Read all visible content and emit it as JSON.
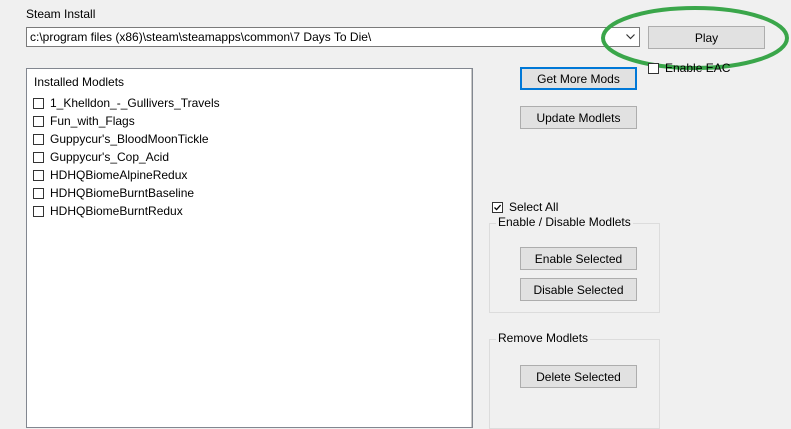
{
  "steam_install": {
    "label": "Steam Install",
    "path": "c:\\program files (x86)\\steam\\steamapps\\common\\7 Days To Die\\"
  },
  "buttons": {
    "play": "Play",
    "get_more_mods": "Get More Mods",
    "update_modlets": "Update Modlets",
    "enable_selected": "Enable Selected",
    "disable_selected": "Disable Selected",
    "delete_selected": "Delete Selected"
  },
  "enable_eac": {
    "label": "Enable EAC",
    "checked": false
  },
  "modlets": {
    "title": "Installed Modlets",
    "items": [
      {
        "name": "1_Khelldon_-_Gullivers_Travels",
        "checked": false
      },
      {
        "name": "Fun_with_Flags",
        "checked": false
      },
      {
        "name": "Guppycur's_BloodMoonTickle",
        "checked": false
      },
      {
        "name": "Guppycur's_Cop_Acid",
        "checked": false
      },
      {
        "name": "HDHQBiomeAlpineRedux",
        "checked": false
      },
      {
        "name": "HDHQBiomeBurntBaseline",
        "checked": false
      },
      {
        "name": "HDHQBiomeBurntRedux",
        "checked": false
      }
    ]
  },
  "select_all": {
    "label": "Select All",
    "checked": true
  },
  "groups": {
    "enable_disable": "Enable / Disable Modlets",
    "remove": "Remove Modlets"
  },
  "colors": {
    "highlight": "#3aa64a",
    "accent": "#0078d7"
  }
}
